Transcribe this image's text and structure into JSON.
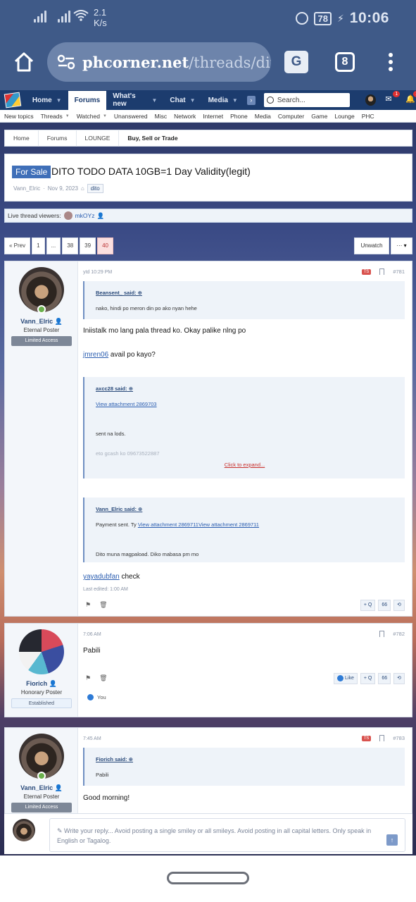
{
  "status_bar": {
    "speed_value": "2.1",
    "speed_unit": "K/s",
    "battery": "78",
    "time": "10:06"
  },
  "browser": {
    "url_host": "phcorner.net",
    "url_path": "/threads/dito-to",
    "tab_count": "8",
    "translate_glyph": "G"
  },
  "nav": {
    "tabs": [
      {
        "label": "Home"
      },
      {
        "label": "Forums"
      },
      {
        "label": "What's new"
      },
      {
        "label": "Chat"
      },
      {
        "label": "Media"
      }
    ],
    "more": "›",
    "search_placeholder": "Search...",
    "inbox_badge": "1",
    "alerts_badge": "1"
  },
  "subnav": [
    "New topics",
    "Threads",
    "Watched",
    "Unanswered",
    "Misc",
    "Network",
    "Internet",
    "Phone",
    "Media",
    "Computer",
    "Game",
    "Lounge",
    "PHC"
  ],
  "breadcrumb": [
    "Home",
    "Forums",
    "LOUNGE",
    "Buy, Sell or Trade"
  ],
  "thread": {
    "prefix": "For Sale",
    "title": "DITO TODO DATA 10GB=1 Day Validity(legit)",
    "author": "Vann_Elric",
    "date": "Nov 9, 2023",
    "tag": "dito"
  },
  "viewers": {
    "label": "Live thread viewers:",
    "name": "mkOYz"
  },
  "pager": {
    "prev": "« Prev",
    "pages": [
      "1",
      "...",
      "38",
      "39",
      "40"
    ],
    "unwatch": "Unwatch",
    "more": "··· ▾"
  },
  "posts": [
    {
      "user": "Vann_Elric",
      "title": "Eternal Poster",
      "banner": "Limited Access",
      "time": "ytd 10:29 PM",
      "ts": "TS",
      "number": "#781",
      "quote1": {
        "author": "Beansent_ said:",
        "text": "nako, hindi po meron din po ako nyan hehe"
      },
      "line1": "Iniistalk mo lang pala thread ko. Okay palike nlng po",
      "mention1": "jmren06",
      "line2": " avail po kayo?",
      "quote2": {
        "author": "axcc28 said:",
        "link": "View attachment 2869703",
        "text": "sent na lods.",
        "faded": "eto gcash ko 09673522887",
        "expand": "Click to expand..."
      },
      "quote3": {
        "author": "Vann_Elric said:",
        "prefix": "Payment sent. Ty ",
        "link1": "View attachment 2869711",
        "link2": "View attachment 2869711",
        "text": "Dito muna magpaload. Diko mabasa pm mo"
      },
      "mention2": "yayadubfan",
      "line3": " check",
      "edited": "Last edited: 1:00 AM"
    },
    {
      "user": "Fiorich",
      "title": "Honorary Poster",
      "banner": "Established",
      "time": "7:06 AM",
      "number": "#782",
      "text": "Pabili",
      "like": "Like",
      "reaction": "You"
    },
    {
      "user": "Vann_Elric",
      "title": "Eternal Poster",
      "banner": "Limited Access",
      "time": "7:45 AM",
      "ts": "TS",
      "number": "#783",
      "quote": {
        "author": "Fiorich said:",
        "text": "Pabili"
      },
      "text": "Good morning!"
    }
  ],
  "actions": {
    "quote": "+ Q",
    "multi": "66",
    "reply": "⟲"
  },
  "reply": {
    "placeholder": "Write your reply... Avoid posting a single smiley or all smileys. Avoid posting in all capital letters. Only speak in English or Tagalog."
  }
}
